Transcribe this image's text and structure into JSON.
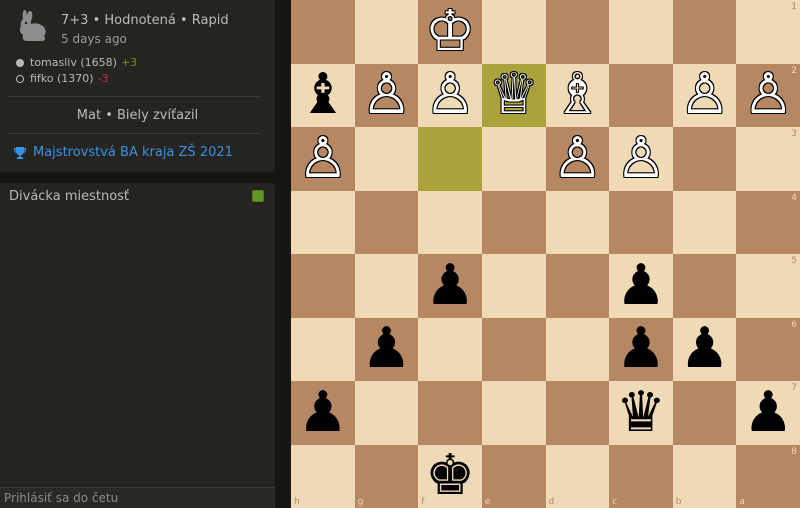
{
  "game": {
    "type": "7+3 • Hodnotená • Rapid",
    "ago": "5 days ago",
    "result": "Mat • Biely zvíťazil",
    "tournament": "Majstrovstvá BA kraja ZŠ 2021"
  },
  "players": [
    {
      "name": "tomasliv (1658)",
      "diff": "+3",
      "color": "white"
    },
    {
      "name": "fifko (1370)",
      "diff": "-3",
      "color": "black"
    }
  ],
  "chat": {
    "title": "Divácka miestnosť",
    "placeholder": "Prihlásiť sa do četu"
  },
  "colors": {
    "light_square": "#f0d9b5",
    "dark_square": "#b58863",
    "highlight": "#cdd26a",
    "link": "#3692e7",
    "positive": "#629924",
    "negative": "#cc3333"
  },
  "board": {
    "orientation": "black",
    "files": [
      "h",
      "g",
      "f",
      "e",
      "d",
      "c",
      "b",
      "a"
    ],
    "ranks": [
      "1",
      "2",
      "3",
      "4",
      "5",
      "6",
      "7",
      "8"
    ],
    "highlight": [
      "e2",
      "f3"
    ],
    "pieces": [
      {
        "sq": "f1",
        "piece": "K",
        "color": "w",
        "name": "white-king"
      },
      {
        "sq": "h2",
        "piece": "B",
        "color": "b",
        "name": "black-bishop"
      },
      {
        "sq": "g2",
        "piece": "P",
        "color": "w",
        "name": "white-pawn"
      },
      {
        "sq": "f2",
        "piece": "P",
        "color": "w",
        "name": "white-pawn"
      },
      {
        "sq": "e2",
        "piece": "Q",
        "color": "w",
        "name": "white-queen"
      },
      {
        "sq": "d2",
        "piece": "B",
        "color": "w",
        "name": "white-bishop"
      },
      {
        "sq": "b2",
        "piece": "P",
        "color": "w",
        "name": "white-pawn"
      },
      {
        "sq": "a2",
        "piece": "P",
        "color": "w",
        "name": "white-pawn"
      },
      {
        "sq": "h3",
        "piece": "P",
        "color": "w",
        "name": "white-pawn"
      },
      {
        "sq": "d3",
        "piece": "P",
        "color": "w",
        "name": "white-pawn"
      },
      {
        "sq": "c3",
        "piece": "P",
        "color": "w",
        "name": "white-pawn"
      },
      {
        "sq": "f5",
        "piece": "P",
        "color": "b",
        "name": "black-pawn"
      },
      {
        "sq": "c5",
        "piece": "P",
        "color": "b",
        "name": "black-pawn"
      },
      {
        "sq": "g6",
        "piece": "P",
        "color": "b",
        "name": "black-pawn"
      },
      {
        "sq": "c6",
        "piece": "P",
        "color": "b",
        "name": "black-pawn"
      },
      {
        "sq": "b6",
        "piece": "P",
        "color": "b",
        "name": "black-pawn"
      },
      {
        "sq": "h7",
        "piece": "P",
        "color": "b",
        "name": "black-pawn"
      },
      {
        "sq": "c7",
        "piece": "Q",
        "color": "b",
        "name": "black-queen"
      },
      {
        "sq": "a7",
        "piece": "P",
        "color": "b",
        "name": "black-pawn"
      },
      {
        "sq": "f8",
        "piece": "K",
        "color": "b",
        "name": "black-king"
      }
    ]
  }
}
